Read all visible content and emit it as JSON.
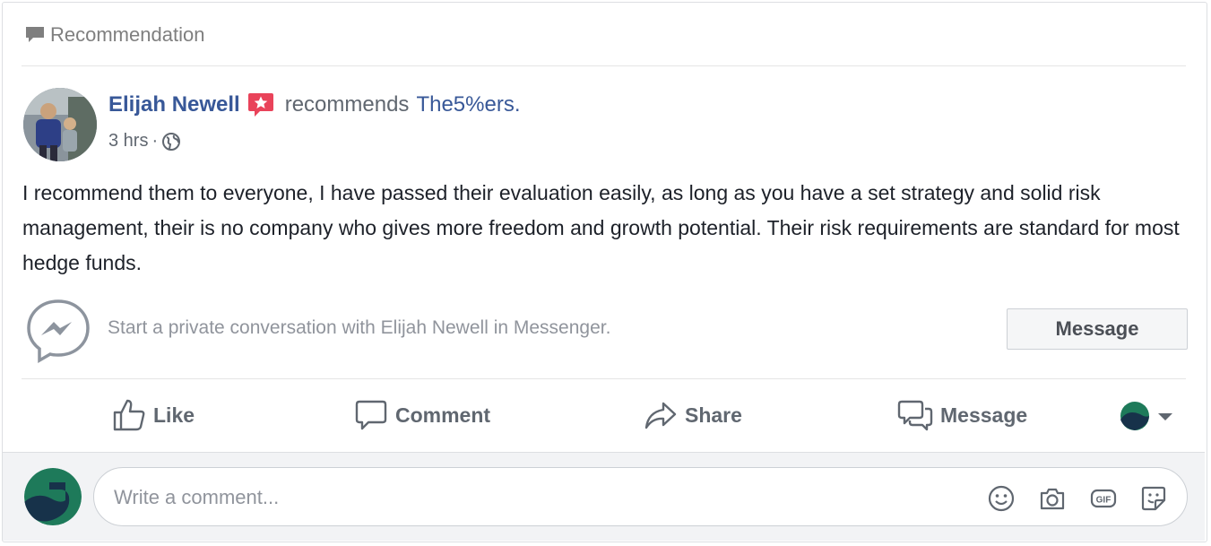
{
  "header": {
    "label": "Recommendation"
  },
  "post": {
    "author": "Elijah Newell",
    "verb": "recommends",
    "page": "The5%ers.",
    "time": "3 hrs",
    "separator": "·",
    "body": "I recommend them to everyone, I have passed their evaluation easily, as long as you have a set strategy and solid risk management, their is no company who gives more freedom and growth potential. Their risk requirements are standard for most hedge funds."
  },
  "messenger": {
    "prompt": "Start a private conversation with Elijah Newell in Messenger.",
    "button": "Message"
  },
  "actions": {
    "like": "Like",
    "comment": "Comment",
    "share": "Share",
    "message": "Message"
  },
  "comment": {
    "placeholder": "Write a comment..."
  },
  "icons": [
    "comment-bubble-icon",
    "recommendation-badge-icon",
    "globe-icon",
    "messenger-icon",
    "like-icon",
    "comment-icon",
    "share-icon",
    "message-icon",
    "audience-selector-icon",
    "chevron-down-icon",
    "emoji-icon",
    "camera-icon",
    "gif-icon",
    "sticker-icon"
  ],
  "colors": {
    "link": "#385898",
    "muted": "#606770",
    "badge": "#e9435a",
    "brand_green": "#1e7a5a",
    "brand_dark": "#17324a"
  }
}
